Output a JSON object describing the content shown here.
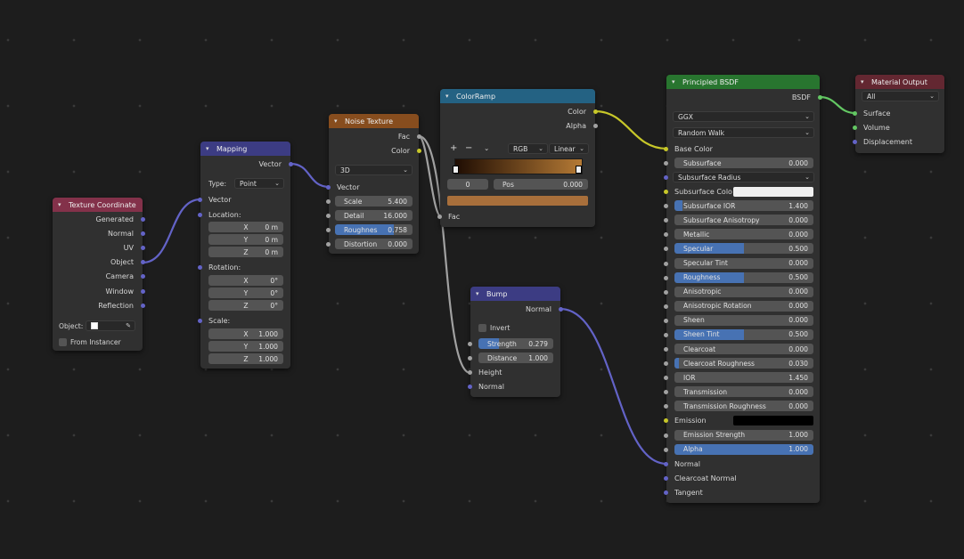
{
  "nodes": {
    "texcoord": {
      "title": "Texture Coordinate",
      "outputs": [
        "Generated",
        "Normal",
        "UV",
        "Object",
        "Camera",
        "Window",
        "Reflection"
      ],
      "object_label": "Object:",
      "from_instancer": "From Instancer"
    },
    "mapping": {
      "title": "Mapping",
      "output": "Vector",
      "type_label": "Type:",
      "type_value": "Point",
      "vector_input": "Vector",
      "location_label": "Location:",
      "location": [
        {
          "axis": "X",
          "value": "0 m"
        },
        {
          "axis": "Y",
          "value": "0 m"
        },
        {
          "axis": "Z",
          "value": "0 m"
        }
      ],
      "rotation_label": "Rotation:",
      "rotation": [
        {
          "axis": "X",
          "value": "0°"
        },
        {
          "axis": "Y",
          "value": "0°"
        },
        {
          "axis": "Z",
          "value": "0°"
        }
      ],
      "scale_label": "Scale:",
      "scale": [
        {
          "axis": "X",
          "value": "1.000"
        },
        {
          "axis": "Y",
          "value": "1.000"
        },
        {
          "axis": "Z",
          "value": "1.000"
        }
      ]
    },
    "noise": {
      "title": "Noise Texture",
      "outputs": [
        "Fac",
        "Color"
      ],
      "dimension": "3D",
      "vector_input": "Vector",
      "fields": [
        {
          "label": "Scale",
          "value": "5.400",
          "fill": 0
        },
        {
          "label": "Detail",
          "value": "16.000",
          "fill": 0
        },
        {
          "label": "Roughnes",
          "value": "0.758",
          "fill": 0.758
        },
        {
          "label": "Distortion",
          "value": "0.000",
          "fill": 0
        }
      ]
    },
    "colorramp": {
      "title": "ColorRamp",
      "outputs": [
        "Color",
        "Alpha"
      ],
      "add": "+",
      "remove": "−",
      "color_mode": "RGB",
      "interpolation": "Linear",
      "stop_index": "0",
      "pos_label": "Pos",
      "pos_value": "0.000",
      "fac_input": "Fac",
      "ramp_start": "#1f0d03",
      "ramp_end": "#b57a35",
      "selected_color": "#a86f3b"
    },
    "bump": {
      "title": "Bump",
      "output": "Normal",
      "invert": "Invert",
      "fields": [
        {
          "label": "Strength",
          "value": "0.279",
          "fill": 0.279
        },
        {
          "label": "Distance",
          "value": "1.000",
          "fill": 0
        }
      ],
      "inputs": [
        "Height",
        "Normal"
      ]
    },
    "bsdf": {
      "title": "Principled BSDF",
      "output": "BSDF",
      "distribution": "GGX",
      "subsurface_method": "Random Walk",
      "base_color": "Base Color",
      "rows": [
        {
          "label": "Subsurface",
          "value": "0.000",
          "fill": 0
        },
        {
          "label": "Subsurface Radius",
          "type": "dropdown"
        },
        {
          "label": "Subsurface Colo",
          "type": "color",
          "color": "#f0f0f0"
        },
        {
          "label": "Subsurface IOR",
          "value": "1.400",
          "fill": 0.06
        },
        {
          "label": "Subsurface Anisotropy",
          "value": "0.000",
          "fill": 0
        },
        {
          "label": "Metallic",
          "value": "0.000",
          "fill": 0
        },
        {
          "label": "Specular",
          "value": "0.500",
          "fill": 0.5
        },
        {
          "label": "Specular Tint",
          "value": "0.000",
          "fill": 0
        },
        {
          "label": "Roughness",
          "value": "0.500",
          "fill": 0.5
        },
        {
          "label": "Anisotropic",
          "value": "0.000",
          "fill": 0
        },
        {
          "label": "Anisotropic Rotation",
          "value": "0.000",
          "fill": 0
        },
        {
          "label": "Sheen",
          "value": "0.000",
          "fill": 0
        },
        {
          "label": "Sheen Tint",
          "value": "0.500",
          "fill": 0.5
        },
        {
          "label": "Clearcoat",
          "value": "0.000",
          "fill": 0
        },
        {
          "label": "Clearcoat Roughness",
          "value": "0.030",
          "fill": 0.03
        },
        {
          "label": "IOR",
          "value": "1.450",
          "fill": 0
        },
        {
          "label": "Transmission",
          "value": "0.000",
          "fill": 0
        },
        {
          "label": "Transmission Roughness",
          "value": "0.000",
          "fill": 0
        },
        {
          "label": "Emission",
          "type": "color",
          "color": "#000000"
        },
        {
          "label": "Emission Strength",
          "value": "1.000",
          "fill": 0
        },
        {
          "label": "Alpha",
          "value": "1.000",
          "fill": 1
        },
        {
          "label": "Normal",
          "type": "socket"
        },
        {
          "label": "Clearcoat Normal",
          "type": "socket"
        },
        {
          "label": "Tangent",
          "type": "socket"
        }
      ]
    },
    "output": {
      "title": "Material Output",
      "target": "All",
      "inputs": [
        "Surface",
        "Volume",
        "Displacement"
      ]
    }
  },
  "colors": {
    "header_input": "#83314a",
    "header_vector": "#3c3c83",
    "header_texture": "#874d1e",
    "header_converter": "#246283",
    "header_shader": "#28752f",
    "header_output": "#632731",
    "slider_fill": "#4772b3"
  }
}
